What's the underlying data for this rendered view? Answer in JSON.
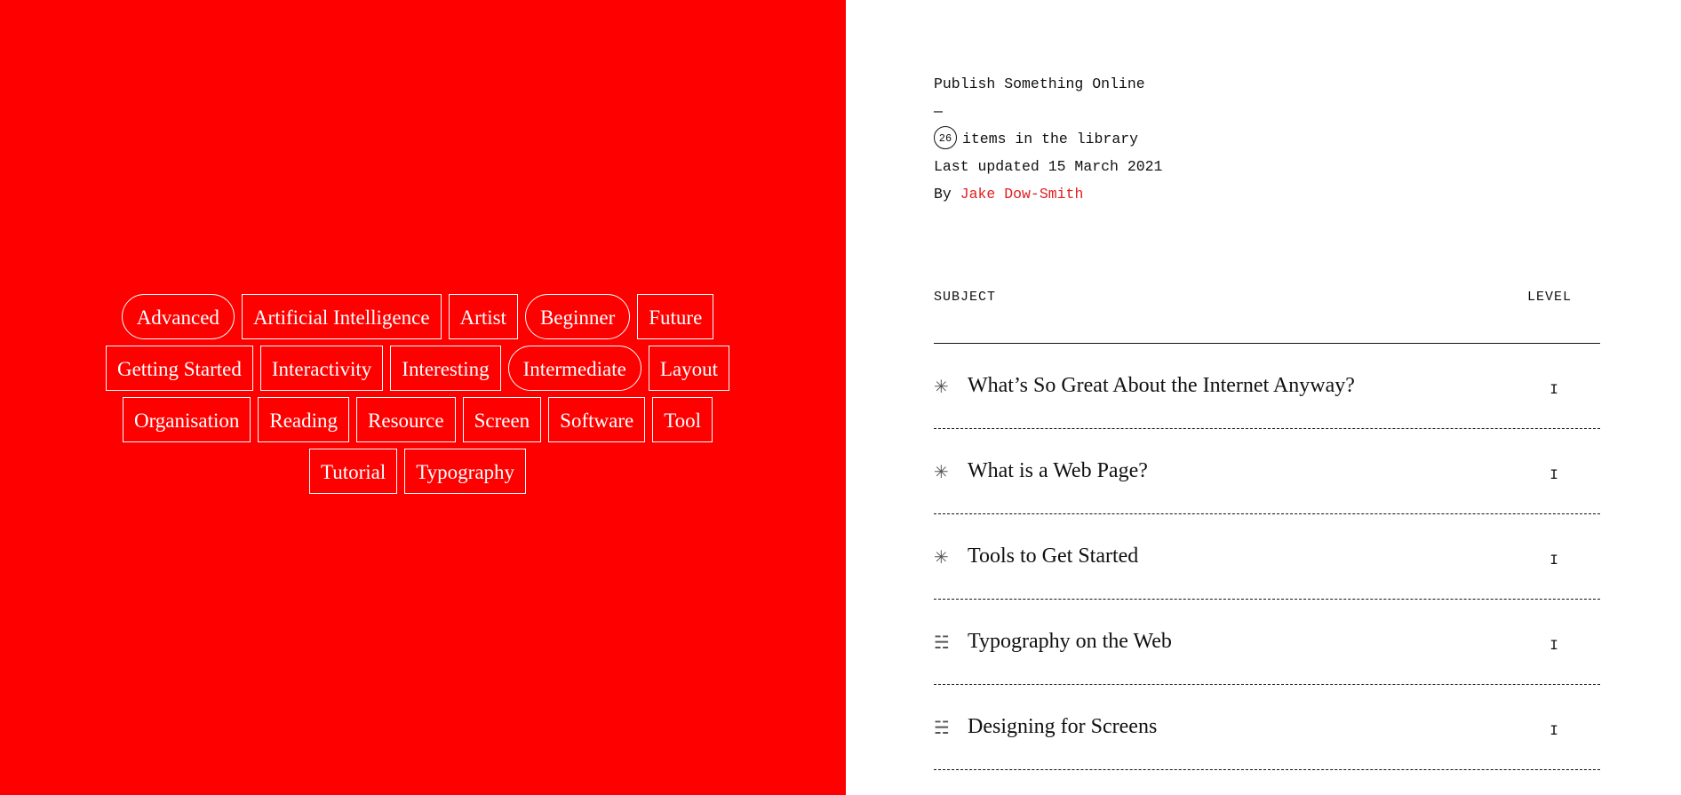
{
  "tags": {
    "rows": [
      [
        {
          "label": "Advanced",
          "shape": "pill"
        },
        {
          "label": "Artificial Intelligence",
          "shape": "box"
        },
        {
          "label": "Artist",
          "shape": "box"
        },
        {
          "label": "Beginner",
          "shape": "pill"
        },
        {
          "label": "Future",
          "shape": "box"
        }
      ],
      [
        {
          "label": "Getting Started",
          "shape": "box"
        },
        {
          "label": "Interactivity",
          "shape": "box"
        },
        {
          "label": "Interesting",
          "shape": "box"
        },
        {
          "label": "Intermediate",
          "shape": "pill"
        },
        {
          "label": "Layout",
          "shape": "box"
        }
      ],
      [
        {
          "label": "Organisation",
          "shape": "box"
        },
        {
          "label": "Reading",
          "shape": "box"
        },
        {
          "label": "Resource",
          "shape": "box"
        },
        {
          "label": "Screen",
          "shape": "box"
        },
        {
          "label": "Software",
          "shape": "box"
        },
        {
          "label": "Tool",
          "shape": "box"
        }
      ],
      [
        {
          "label": "Tutorial",
          "shape": "box"
        },
        {
          "label": "Typography",
          "shape": "box"
        }
      ]
    ]
  },
  "meta": {
    "title": "Publish Something Online",
    "dash": "—",
    "count": "26",
    "count_suffix": "items in the library",
    "updated": "Last updated 15 March 2021",
    "by_label": "By",
    "author": "Jake Dow-Smith"
  },
  "table": {
    "subject_header": "SUBJECT",
    "level_header": "LEVEL",
    "rows": [
      {
        "icon": "asterisk-icon",
        "glyph": "✳",
        "title": "What’s So Great About the Internet Anyway?",
        "level": "I"
      },
      {
        "icon": "asterisk-icon",
        "glyph": "✳",
        "title": "What is a Web Page?",
        "level": "I"
      },
      {
        "icon": "asterisk-icon",
        "glyph": "✳",
        "title": "Tools to Get Started",
        "level": "I"
      },
      {
        "icon": "list-icon",
        "glyph": "☵",
        "title": "Typography on the Web",
        "level": "I"
      },
      {
        "icon": "list-icon",
        "glyph": "☵",
        "title": "Designing for Screens",
        "level": "I"
      }
    ]
  },
  "colors": {
    "left_background": "#ff0000",
    "author_link": "#e02020"
  }
}
